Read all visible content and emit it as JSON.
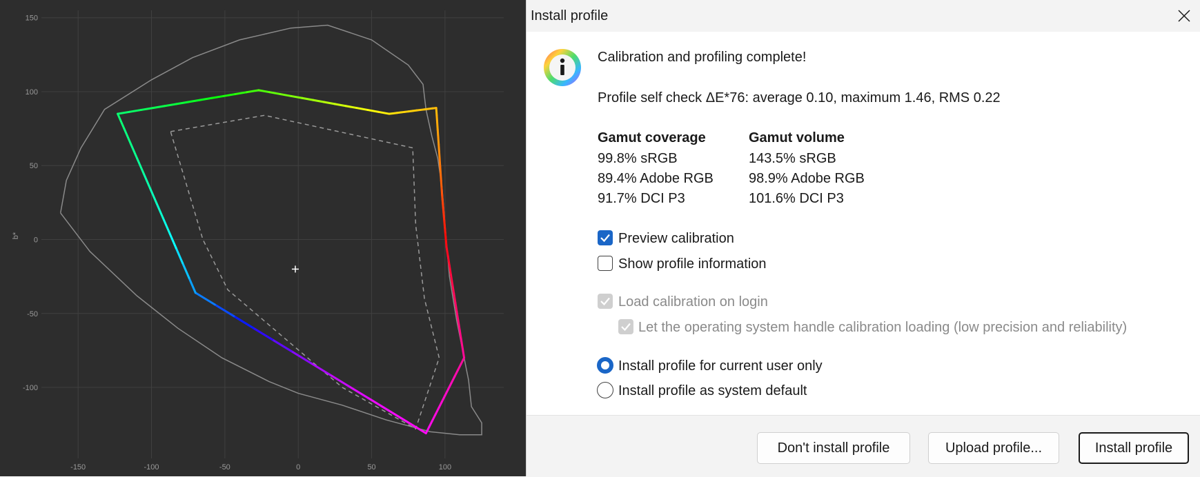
{
  "chart_data": {
    "type": "line",
    "ylabel": "b*",
    "xlim": [
      -175,
      140
    ],
    "ylim": [
      -148,
      155
    ],
    "x_ticks": [
      -150,
      -100,
      -50,
      0,
      50,
      100
    ],
    "y_ticks": [
      150,
      100,
      50,
      0,
      -50,
      -100
    ],
    "grid": true,
    "white_point": [
      -2,
      -20
    ],
    "series": [
      {
        "style": "solid-gray",
        "color": "#8a8a8a",
        "points": [
          [
            -162,
            18
          ],
          [
            -158,
            40
          ],
          [
            -148,
            62
          ],
          [
            -132,
            88
          ],
          [
            -100,
            108
          ],
          [
            -72,
            123
          ],
          [
            -40,
            135
          ],
          [
            -5,
            143
          ],
          [
            20,
            145
          ],
          [
            50,
            135
          ],
          [
            75,
            118
          ],
          [
            85,
            105
          ],
          [
            87,
            88
          ],
          [
            91,
            70
          ],
          [
            95,
            55
          ],
          [
            98,
            35
          ],
          [
            100,
            10
          ],
          [
            103,
            -25
          ],
          [
            108,
            -55
          ],
          [
            116,
            -95
          ],
          [
            118,
            -113
          ],
          [
            125,
            -124
          ],
          [
            125,
            -132
          ],
          [
            110,
            -132
          ],
          [
            90,
            -130
          ],
          [
            60,
            -122
          ],
          [
            30,
            -112
          ],
          [
            0,
            -104
          ],
          [
            -20,
            -96
          ],
          [
            -52,
            -80
          ],
          [
            -82,
            -60
          ],
          [
            -110,
            -38
          ],
          [
            -142,
            -8
          ],
          [
            -162,
            18
          ]
        ]
      },
      {
        "style": "dashed",
        "color": "#9a9a9a",
        "points": [
          [
            -87,
            73
          ],
          [
            -23,
            84
          ],
          [
            78,
            62
          ],
          [
            80,
            10
          ],
          [
            86,
            -40
          ],
          [
            96,
            -80
          ],
          [
            80,
            -128
          ],
          [
            30,
            -100
          ],
          [
            -48,
            -34
          ],
          [
            -65,
            0
          ],
          [
            -87,
            73
          ]
        ]
      }
    ],
    "gamut_outline": [
      [
        -123,
        85
      ],
      [
        -27,
        101
      ],
      [
        62,
        85
      ],
      [
        94,
        89
      ],
      [
        98,
        30
      ],
      [
        101,
        -5
      ],
      [
        113,
        -80
      ],
      [
        87,
        -131
      ],
      [
        -70,
        -36
      ],
      [
        -123,
        85
      ]
    ]
  },
  "dialog": {
    "title": "Install profile",
    "heading": "Calibration and profiling complete!",
    "self_check": "Profile self check ΔE*76: average 0.10, maximum 1.46, RMS 0.22",
    "coverage_header": "Gamut coverage",
    "volume_header": "Gamut volume",
    "coverage": [
      "99.8% sRGB",
      "89.4% Adobe RGB",
      "91.7% DCI P3"
    ],
    "volume": [
      "143.5% sRGB",
      "98.9% Adobe RGB",
      "101.6% DCI P3"
    ],
    "preview_calibration": "Preview calibration",
    "show_profile_information": "Show profile information",
    "load_calibration_on_login": "Load calibration on login",
    "os_handle_calibration": "Let the operating system handle calibration loading (low precision and reliability)",
    "install_current_user": "Install profile for current user only",
    "install_system_default": "Install profile as system default",
    "btn_dont_install": "Don't install profile",
    "btn_upload": "Upload profile...",
    "btn_install": "Install profile",
    "accent_color": "#1a66c7",
    "icon": "info-icon"
  }
}
